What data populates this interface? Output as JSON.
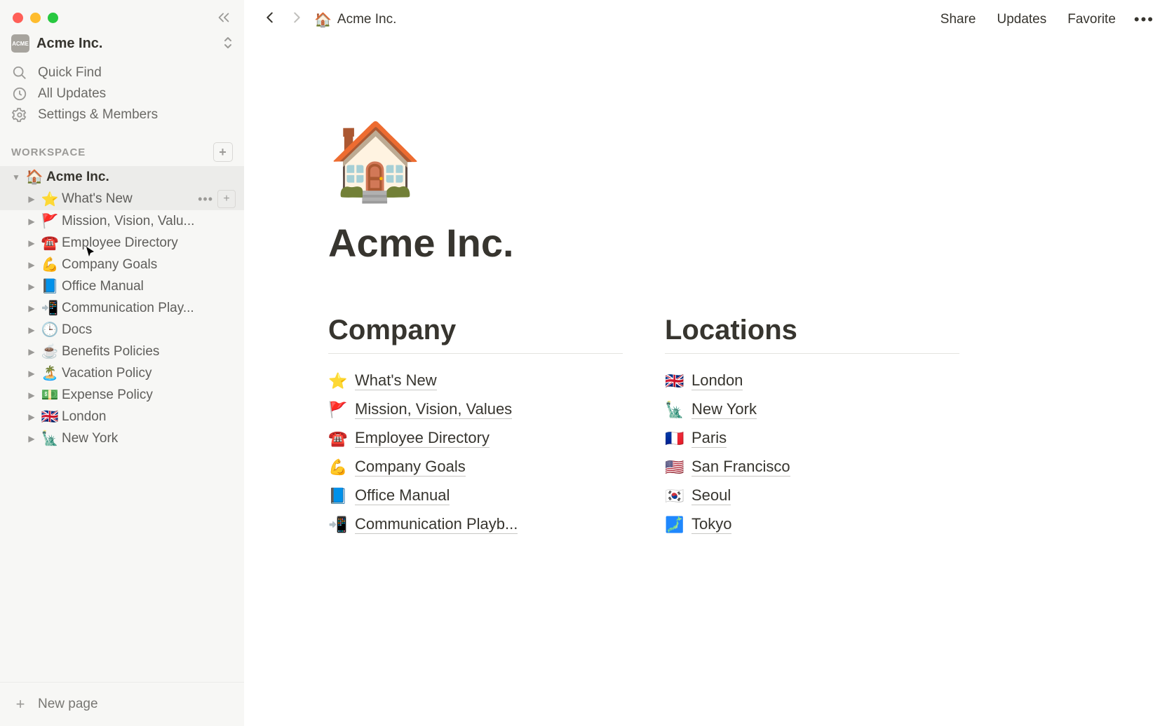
{
  "app": {
    "workspace_name": "Acme Inc.",
    "quick_find": "Quick Find",
    "all_updates": "All Updates",
    "settings_members": "Settings & Members",
    "workspace_section_label": "WORKSPACE",
    "new_page_label": "New page"
  },
  "sidebar_root": {
    "emoji": "🏠",
    "label": "Acme Inc."
  },
  "sidebar_children": [
    {
      "emoji": "⭐",
      "label": "What's New",
      "hovered": true
    },
    {
      "emoji": "🚩",
      "label": "Mission, Vision, Valu..."
    },
    {
      "emoji": "☎️",
      "label": "Employee Directory"
    },
    {
      "emoji": "💪",
      "label": "Company Goals"
    },
    {
      "emoji": "📘",
      "label": "Office Manual"
    },
    {
      "emoji": "📲",
      "label": "Communication Play..."
    },
    {
      "emoji": "🕒",
      "label": "Docs"
    },
    {
      "emoji": "☕",
      "label": "Benefits Policies"
    },
    {
      "emoji": "🏝️",
      "label": "Vacation Policy"
    },
    {
      "emoji": "💵",
      "label": "Expense Policy"
    },
    {
      "emoji": "🇬🇧",
      "label": "London"
    },
    {
      "emoji": "🗽",
      "label": "New York"
    }
  ],
  "breadcrumb": {
    "emoji": "🏠",
    "label": "Acme Inc."
  },
  "topbar_actions": {
    "share": "Share",
    "updates": "Updates",
    "favorite": "Favorite"
  },
  "page": {
    "icon": "🏠",
    "title": "Acme Inc.",
    "column_a_heading": "Company",
    "column_b_heading": "Locations",
    "company_links": [
      {
        "emoji": "⭐",
        "label": "What's New"
      },
      {
        "emoji": "🚩",
        "label": "Mission, Vision, Values"
      },
      {
        "emoji": "☎️",
        "label": "Employee Directory"
      },
      {
        "emoji": "💪",
        "label": "Company Goals"
      },
      {
        "emoji": "📘",
        "label": "Office Manual"
      },
      {
        "emoji": "📲",
        "label": "Communication Playb..."
      }
    ],
    "location_links": [
      {
        "emoji": "🇬🇧",
        "label": "London"
      },
      {
        "emoji": "🗽",
        "label": "New York"
      },
      {
        "emoji": "🇫🇷",
        "label": "Paris"
      },
      {
        "emoji": "🇺🇸",
        "label": "San Francisco"
      },
      {
        "emoji": "🇰🇷",
        "label": "Seoul"
      },
      {
        "emoji": "🗾",
        "label": "Tokyo"
      }
    ]
  }
}
